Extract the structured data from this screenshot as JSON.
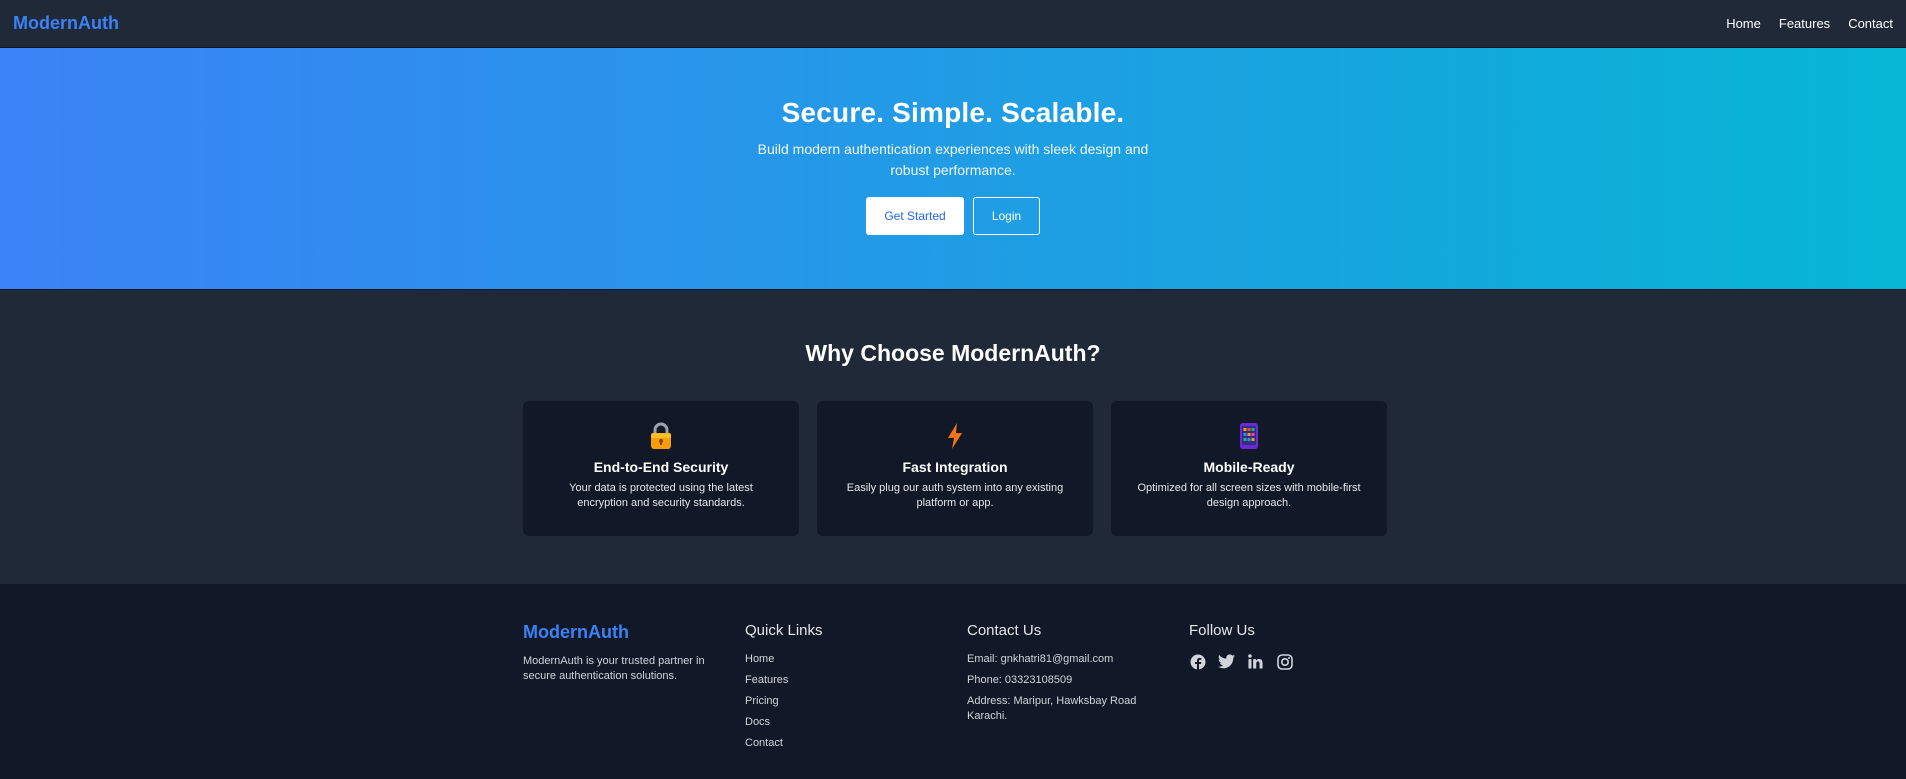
{
  "nav": {
    "brand": "ModernAuth",
    "links": [
      "Home",
      "Features",
      "Contact"
    ]
  },
  "hero": {
    "title": "Secure. Simple. Scalable.",
    "subtitle": "Build modern authentication experiences with sleek design and robust performance.",
    "primary_button": "Get Started",
    "secondary_button": "Login"
  },
  "features": {
    "title": "Why Choose ModernAuth?",
    "cards": [
      {
        "icon": "lock-icon",
        "title": "End-to-End Security",
        "desc": "Your data is protected using the latest encryption and security standards."
      },
      {
        "icon": "lightning-icon",
        "title": "Fast Integration",
        "desc": "Easily plug our auth system into any existing platform or app."
      },
      {
        "icon": "mobile-phone-icon",
        "title": "Mobile-Ready",
        "desc": "Optimized for all screen sizes with mobile-first design approach."
      }
    ]
  },
  "footer": {
    "brand": "ModernAuth",
    "about": "ModernAuth is your trusted partner in secure authentication solutions.",
    "quick_links_heading": "Quick Links",
    "quick_links": [
      "Home",
      "Features",
      "Pricing",
      "Docs",
      "Contact"
    ],
    "contact_heading": "Contact Us",
    "contact": [
      "Email: gnkhatri81@gmail.com",
      "Phone: 03323108509",
      "Address: Maripur, Hawksbay Road Karachi."
    ],
    "follow_heading": "Follow Us",
    "social": [
      "facebook-icon",
      "twitter-icon",
      "linkedin-icon",
      "instagram-icon"
    ]
  },
  "colors": {
    "brand": "#3b82f6",
    "gradient_start": "#3b82f6",
    "gradient_end": "#06b6d4",
    "surface": "#1f2937",
    "dark": "#111827"
  }
}
